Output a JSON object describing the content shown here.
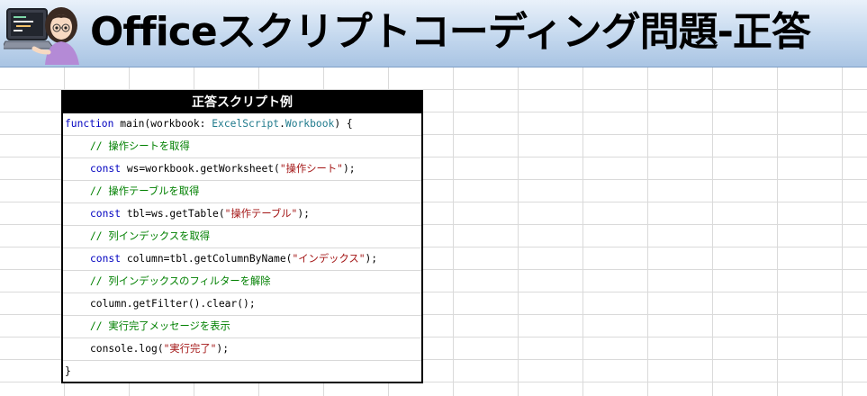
{
  "banner": {
    "title": "Officeスクリプトコーディング問題-正答"
  },
  "code_panel": {
    "header": "正答スクリプト例",
    "lines": [
      {
        "function_kw": "function",
        "signature_plain": " main(workbook: ",
        "type_a": "ExcelScript",
        "dot": ".",
        "type_b": "Workbook",
        "close": ") {"
      },
      {
        "comment": "// 操作シートを取得"
      },
      {
        "kw": "const",
        "code": " ws=workbook.getWorksheet(",
        "str": "\"操作シート\"",
        "tail": ");"
      },
      {
        "comment": "// 操作テーブルを取得"
      },
      {
        "kw": "const",
        "code": " tbl=ws.getTable(",
        "str": "\"操作テーブル\"",
        "tail": ");"
      },
      {
        "comment": "// 列インデックスを取得"
      },
      {
        "kw": "const",
        "code": " column=tbl.getColumnByName(",
        "str": "\"インデックス\"",
        "tail": ");"
      },
      {
        "comment": "// 列インデックスのフィルターを解除"
      },
      {
        "code": "column.getFilter().clear();"
      },
      {
        "comment": "// 実行完了メッセージを表示"
      },
      {
        "code": "console.log(",
        "str": "\"実行完了\"",
        "tail": ");"
      },
      {
        "code": "}"
      }
    ]
  },
  "colors": {
    "keyword": "#0000c0",
    "type": "#1f7a8c",
    "comment": "#008000",
    "string": "#a31515"
  },
  "icons": {
    "illustration": "person-at-laptop-icon"
  }
}
